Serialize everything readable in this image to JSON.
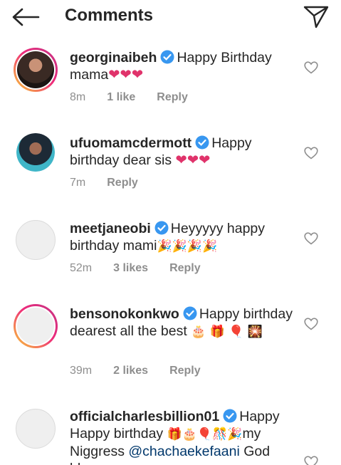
{
  "header": {
    "title": "Comments"
  },
  "comments": [
    {
      "username": "georginaibeh",
      "text": "Happy Birthday mama",
      "emoji": "❤❤❤",
      "time": "8m",
      "likes": "1 like",
      "reply": "Reply"
    },
    {
      "username": "ufuomamcdermott",
      "text": "Happy birthday dear sis",
      "emoji": "❤❤❤",
      "time": "7m",
      "likes": "",
      "reply": "Reply"
    },
    {
      "username": "meetjaneobi",
      "text": "Heyyyyy happy birthday mami",
      "emoji": "🎉🎉🎉🎉",
      "time": "52m",
      "likes": "3 likes",
      "reply": "Reply"
    },
    {
      "username": "bensonokonkwo",
      "text": "Happy birthday dearest all the best",
      "emoji": "🎂 🎁 🎈 🎇",
      "time": "39m",
      "likes": "2 likes",
      "reply": "Reply"
    },
    {
      "username": "officialcharlesbillion01",
      "text_a": "Happy Happy birthday",
      "emoji": "🎁🎂🎈🎊🎉",
      "text_b": "my Niggress",
      "mention": "@chachaekefaani",
      "text_c": "God bless your new age"
    }
  ],
  "colors": {
    "verified": "#3897f0",
    "heart": "#e0336b",
    "meta": "#8e8e8e",
    "mention": "#00376b"
  }
}
